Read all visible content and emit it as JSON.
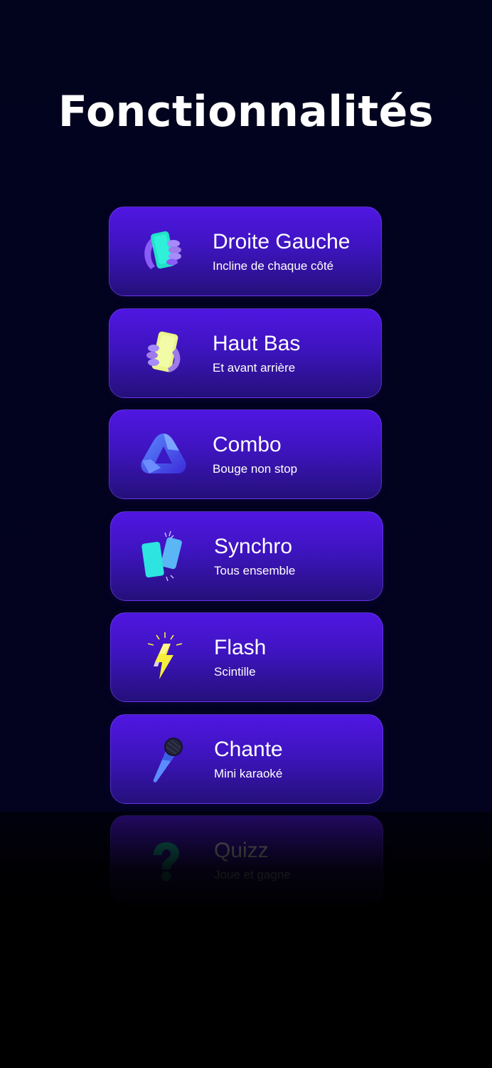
{
  "page": {
    "title": "Fonctionnalités"
  },
  "features": [
    {
      "label": "Droite Gauche",
      "sub": "Incline de chaque côté",
      "icon": "phone-hand-tilt-icon"
    },
    {
      "label": "Haut Bas",
      "sub": "Et avant arrière",
      "icon": "phone-hand-up-icon"
    },
    {
      "label": "Combo",
      "sub": "Bouge non stop",
      "icon": "triangle-loop-icon"
    },
    {
      "label": "Synchro",
      "sub": "Tous ensemble",
      "icon": "two-phones-icon"
    },
    {
      "label": "Flash",
      "sub": "Scintille",
      "icon": "lightning-icon"
    },
    {
      "label": "Chante",
      "sub": "Mini karaoké",
      "icon": "microphone-icon"
    },
    {
      "label": "Quizz",
      "sub": "Joue et gagne",
      "icon": "question-mark-icon"
    }
  ],
  "colors": {
    "background": "#02031d",
    "card_top": "#5016e2",
    "card_bottom": "#24107a",
    "text": "#ffffff"
  }
}
